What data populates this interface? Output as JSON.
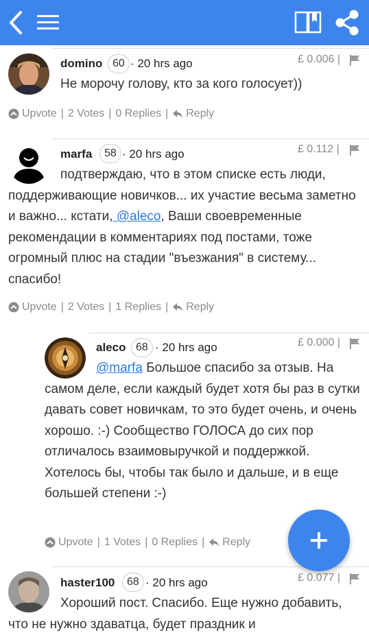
{
  "topbar": {
    "back_icon": "chevron-left-icon",
    "menu_icon": "hamburger-menu-icon",
    "book_icon": "open-book-icon",
    "share_icon": "share-icon",
    "color": "#3d85ec"
  },
  "comments": [
    {
      "author": "domino",
      "reputation": "60",
      "time": "· 20 hrs ago",
      "payout": "£ 0.006 |",
      "text": "Не морочу голову, кто за кого голосует))",
      "actions": {
        "upvote": "Upvote",
        "votes": "2 Votes",
        "replies": "0 Replies",
        "reply": "Reply"
      }
    },
    {
      "author": "marfa",
      "reputation": "58",
      "time": "· 20 hrs ago",
      "payout": "£ 0.112 |",
      "text_before": "подтверждаю, что в этом списке есть люди, поддерживающие новичков... их участие весьма заметно и важно... кстати,",
      "mention": " @aleco",
      "text_after": ", Ваши своевременные рекомендации в комментариях под постами, тоже огромный плюс на стадии \"въезжания\" в систему... спасибо!",
      "actions": {
        "upvote": "Upvote",
        "votes": "2 Votes",
        "replies": "1 Replies",
        "reply": "Reply"
      }
    },
    {
      "author": "aleco",
      "reputation": "68",
      "time": "· 20 hrs ago",
      "payout": "£ 0.000 |",
      "mention": "@marfa",
      "text_after": " Большое спасибо за отзыв. На самом деле, если каждый будет хотя бы раз в сутки давать совет новичкам, то это будет очень, и очень хорошо. :-) Сообщество ГОЛОСА до сих пор отличалось взаимовыручкой и поддержкой. Хотелось бы, чтобы так было и дальше, и в еще большей степени :-)",
      "actions": {
        "upvote": "Upvote",
        "votes": "1 Votes",
        "replies": "0 Replies",
        "reply": "Reply"
      }
    },
    {
      "author": "haster100",
      "reputation": "68",
      "time": "· 20 hrs ago",
      "payout": "£ 0.077 |",
      "text": "Хороший пост. Спасибо. Еще нужно добавить, что не нужно здаватца, будет праздник и"
    }
  ],
  "fab": {
    "icon": "plus-icon",
    "label": "+"
  },
  "separator": "|",
  "accent_link_color": "#2a7ae2"
}
